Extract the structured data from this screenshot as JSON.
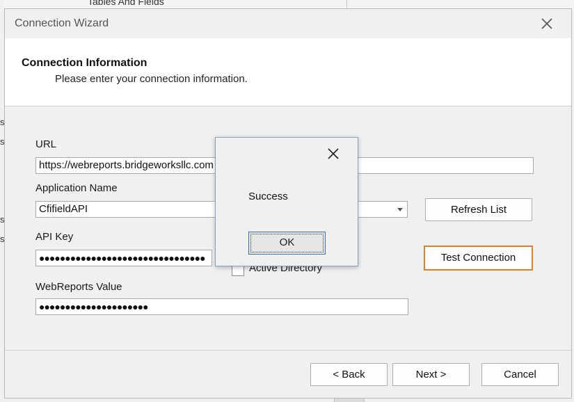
{
  "background": {
    "tab_title": "Tables And Fields",
    "left_fragments": [
      "s",
      "s",
      "s",
      "s"
    ]
  },
  "wizard": {
    "title": "Connection Wizard",
    "header": {
      "title": "Connection Information",
      "subtitle": "Please enter your connection information."
    },
    "fields": {
      "url": {
        "label": "URL",
        "value": "https://webreports.bridgeworksllc.com"
      },
      "application_name": {
        "label": "Application Name",
        "value": "CfifieldAPI"
      },
      "api_key": {
        "label": "API Key",
        "value": "●●●●●●●●●●●●●●●●●●●●●●●●●●●●●●●●"
      },
      "webreports_value": {
        "label": "WebReports Value",
        "value": "●●●●●●●●●●●●●●●●●●●●●"
      },
      "active_directory": {
        "label": "Active Directory",
        "checked": false
      }
    },
    "buttons": {
      "refresh_list": "Refresh List",
      "test_connection": "Test Connection",
      "back": "< Back",
      "next": "Next >",
      "cancel": "Cancel"
    }
  },
  "dialog": {
    "message": "Success",
    "ok": "OK"
  },
  "colors": {
    "focus_accent": "#e67e22",
    "window_bg": "#f0f0f0",
    "header_bg": "#ffffff"
  }
}
